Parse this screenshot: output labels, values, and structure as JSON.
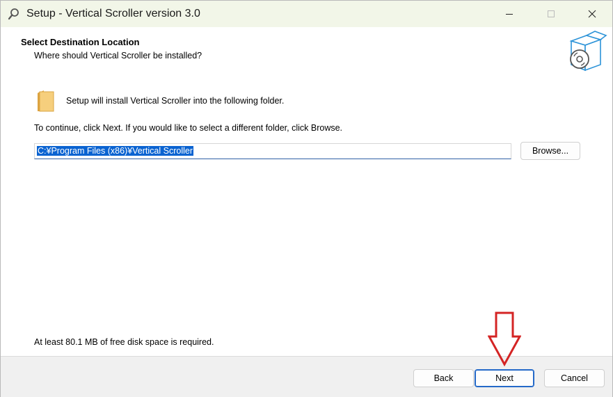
{
  "window": {
    "title": "Setup - Vertical Scroller version 3.0"
  },
  "header": {
    "title": "Select Destination Location",
    "subtitle": "Where should Vertical Scroller be installed?"
  },
  "content": {
    "install_text": "Setup will install Vertical Scroller into the following folder.",
    "continue_text": "To continue, click Next. If you would like to select a different folder, click Browse.",
    "path_value": "C:¥Program Files (x86)¥Vertical Scroller",
    "browse_label": "Browse...",
    "disk_space_text": "At least 80.1 MB of free disk space is required."
  },
  "footer": {
    "back_label": "Back",
    "next_label": "Next",
    "cancel_label": "Cancel"
  },
  "colors": {
    "selection": "#0a63d1",
    "annotation_arrow": "#d42424",
    "default_button_border": "#2469c8"
  }
}
